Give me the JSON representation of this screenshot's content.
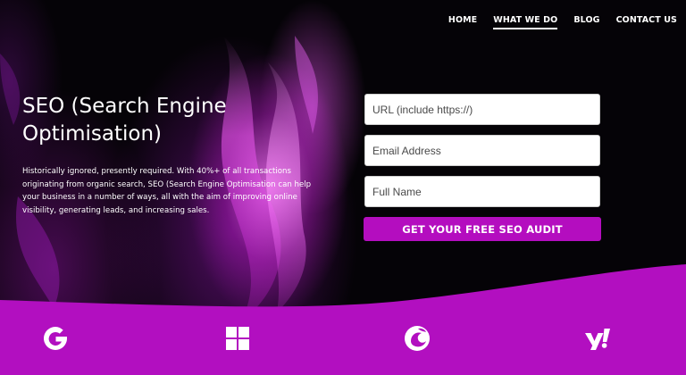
{
  "nav": {
    "items": [
      {
        "label": "HOME",
        "active": false
      },
      {
        "label": "WHAT WE DO",
        "active": true
      },
      {
        "label": "BLOG",
        "active": false
      },
      {
        "label": "CONTACT US",
        "active": false
      }
    ]
  },
  "hero": {
    "title": "SEO (Search Engine Optimisation)",
    "description": "Historically ignored, presently required. With 40%+ of all transactions originating from organic search, SEO (Search Engine Optimisation can help your business in a number of ways, all with the aim of improving online visibility, generating leads, and increasing sales."
  },
  "form": {
    "url_placeholder": "URL (include https://)",
    "email_placeholder": "Email Address",
    "name_placeholder": "Full Name",
    "submit_label": "GET YOUR FREE SEO AUDIT"
  },
  "logos": [
    {
      "name": "google-logo-icon"
    },
    {
      "name": "windows-logo-icon"
    },
    {
      "name": "duckduckgo-logo-icon"
    },
    {
      "name": "yahoo-logo-icon"
    }
  ],
  "colors": {
    "accent": "#b40dbf",
    "band": "#b20fc0",
    "background": "#050307",
    "text": "#ffffff"
  }
}
